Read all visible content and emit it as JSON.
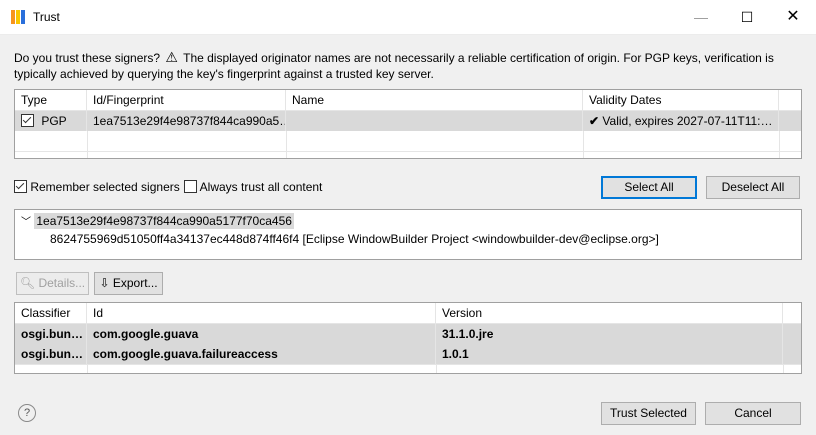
{
  "window": {
    "title": "Trust",
    "minimize": "—",
    "maximize": "☐",
    "close": "✕"
  },
  "question": {
    "part1": "Do you trust these signers?",
    "warning_icon": "warning-icon",
    "part2": "The displayed originator names are not necessarily a reliable certification of origin.  For PGP keys, verification is typically achieved by querying the key's fingerprint against a trusted key server."
  },
  "signers_table": {
    "headers": [
      "Type",
      "Id/Fingerprint",
      "Name",
      "Validity Dates"
    ],
    "rows": [
      {
        "checked": true,
        "type": "PGP",
        "fingerprint": "1ea7513e29f4e98737f844ca990a5…",
        "name": "",
        "validity_icon": "checkmark-icon",
        "validity": "Valid, expires 2027-07-11T11:…"
      }
    ]
  },
  "options": {
    "remember_label": "Remember selected signers",
    "remember_checked": true,
    "always_trust_label": "Always trust all content",
    "always_trust_checked": false,
    "select_all": "Select All",
    "deselect_all": "Deselect All"
  },
  "tree": {
    "root": "1ea7513e29f4e98737f844ca990a5177f70ca456",
    "child": "8624755969d51050ff4a34137ec448d874ff46f4 [Eclipse WindowBuilder Project <windowbuilder-dev@eclipse.org>]"
  },
  "actions": {
    "details": "Details...",
    "export": "Export..."
  },
  "artifacts_table": {
    "headers": [
      "Classifier",
      "Id",
      "Version"
    ],
    "rows": [
      {
        "classifier": "osgi.bun…",
        "id": "com.google.guava",
        "version": "31.1.0.jre"
      },
      {
        "classifier": "osgi.bun…",
        "id": "com.google.guava.failureaccess",
        "version": "1.0.1"
      }
    ]
  },
  "footer": {
    "help": "?",
    "trust_selected": "Trust Selected",
    "cancel": "Cancel"
  }
}
